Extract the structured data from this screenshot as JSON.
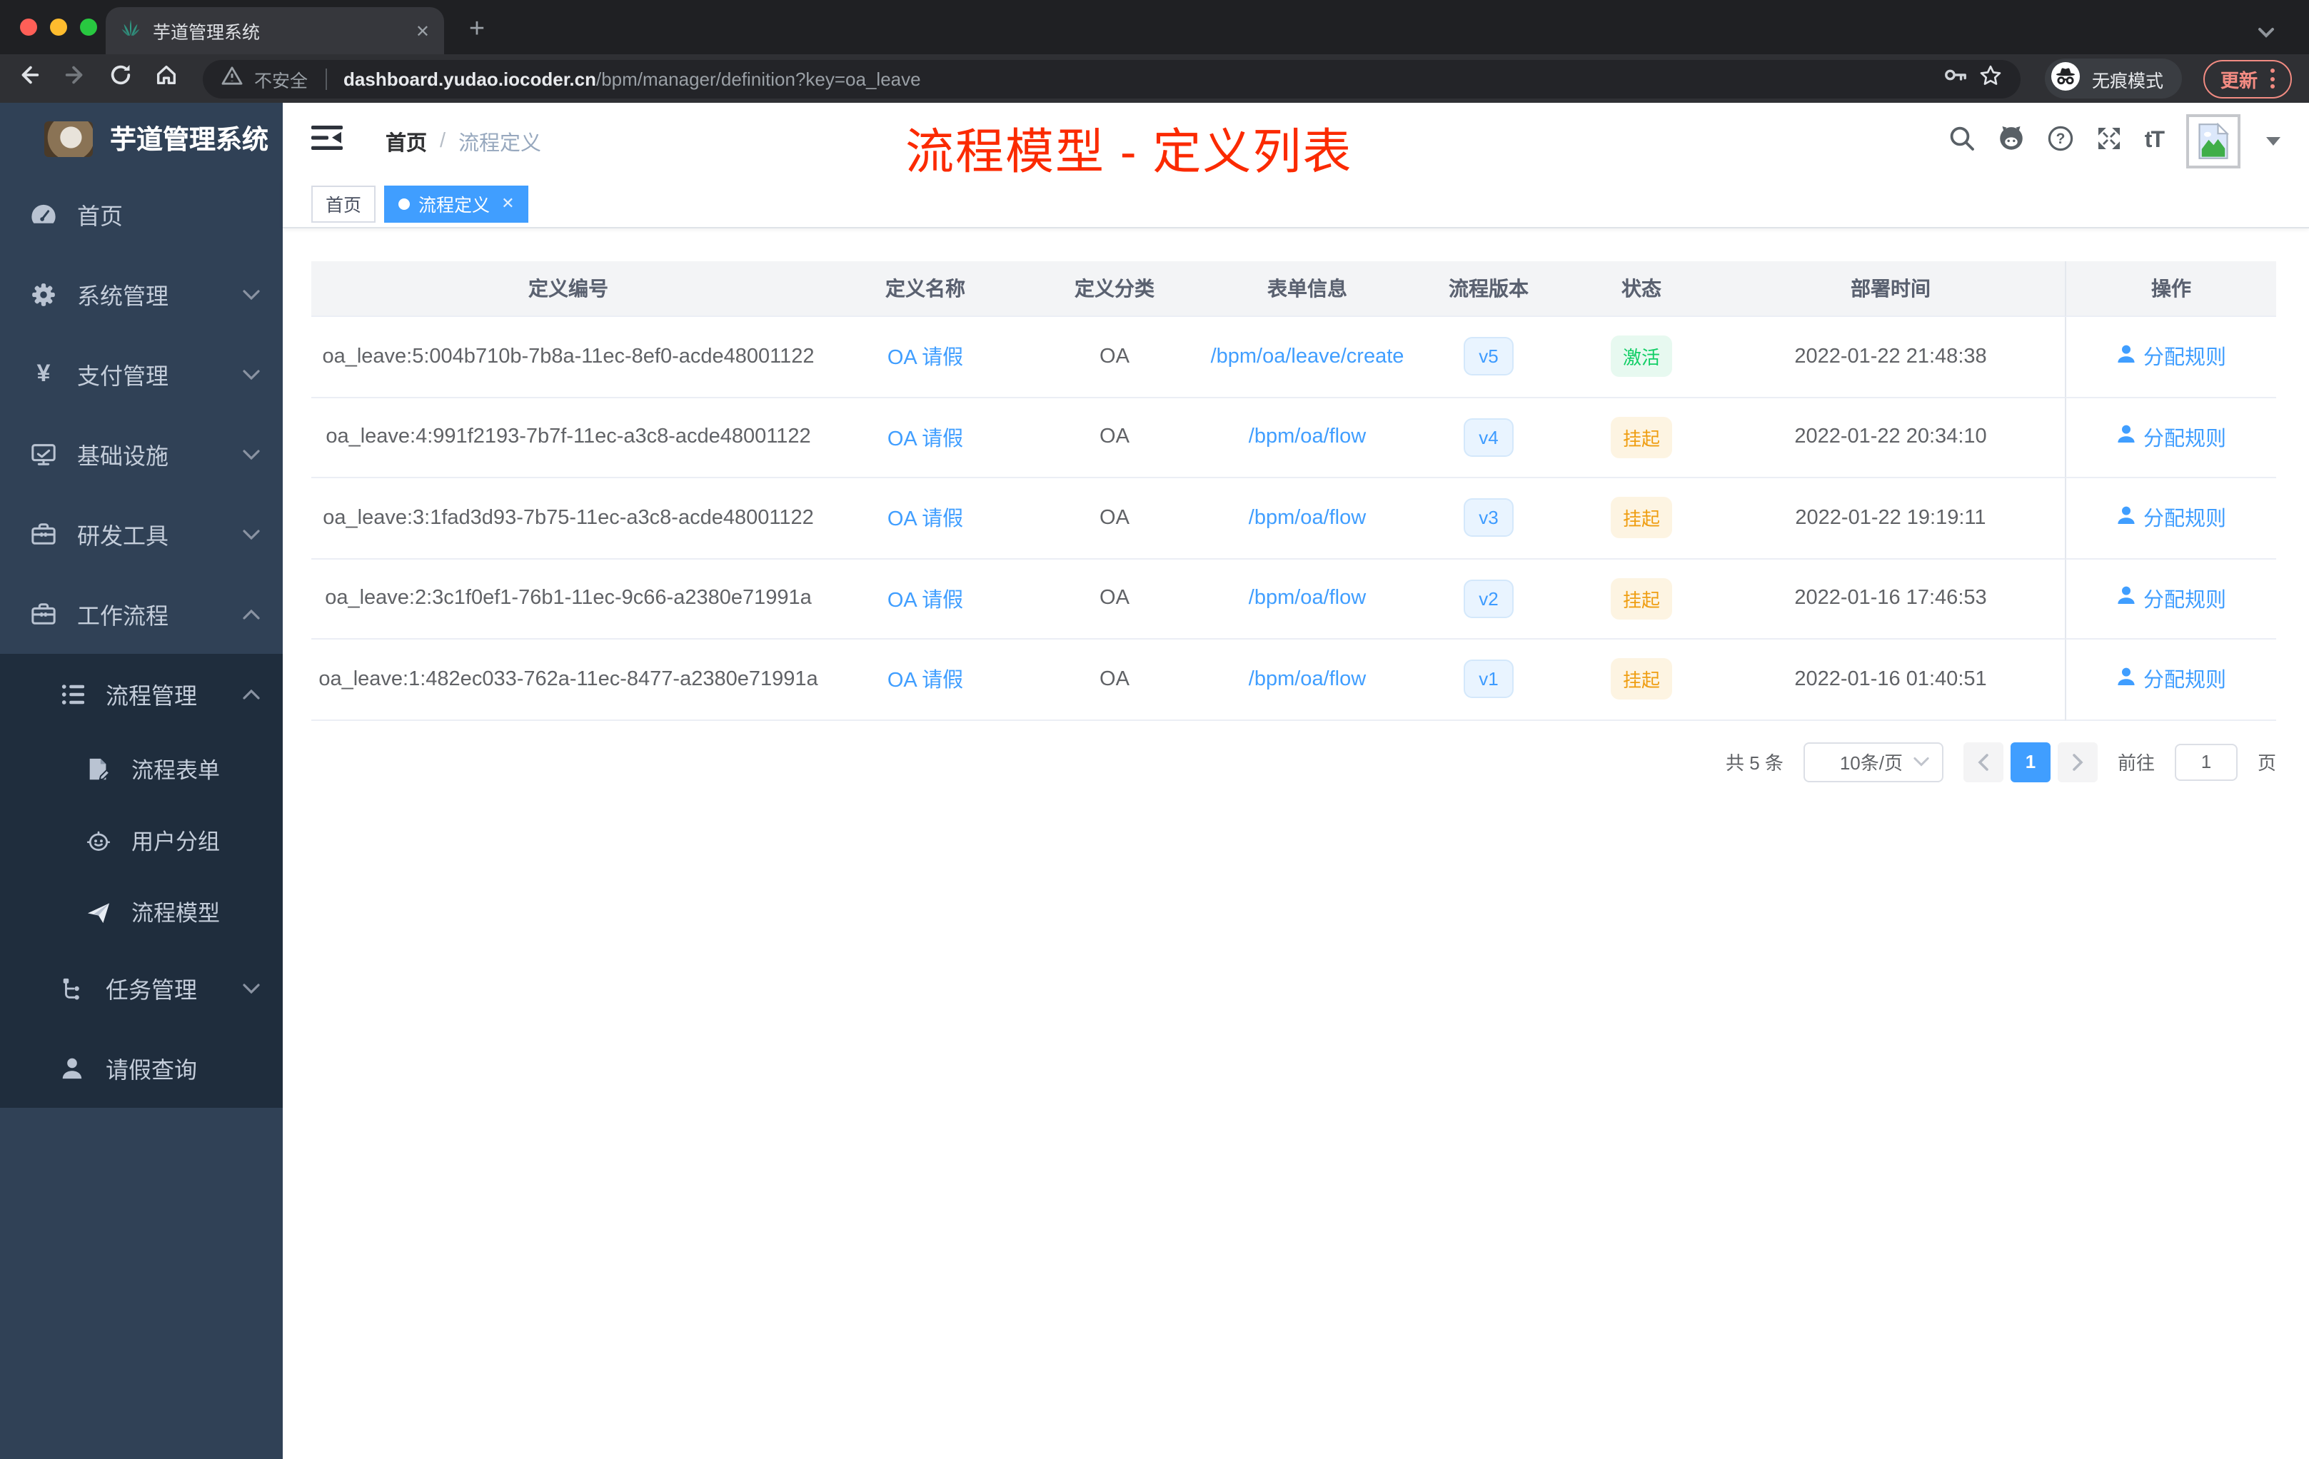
{
  "browser": {
    "tab_title": "芋道管理系统",
    "tab_close": "✕",
    "new_tab": "+",
    "security_label": "不安全",
    "url_domain": "dashboard.yudao.iocoder.cn",
    "url_path": "/bpm/manager/definition?key=oa_leave",
    "incognito_label": "无痕模式",
    "update_label": "更新"
  },
  "sidebar": {
    "logo_title": "芋道管理系统",
    "items": [
      {
        "label": "首页"
      },
      {
        "label": "系统管理"
      },
      {
        "label": "支付管理"
      },
      {
        "label": "基础设施"
      },
      {
        "label": "研发工具"
      },
      {
        "label": "工作流程"
      },
      {
        "label": "流程管理"
      },
      {
        "label": "流程表单"
      },
      {
        "label": "用户分组"
      },
      {
        "label": "流程模型"
      },
      {
        "label": "任务管理"
      },
      {
        "label": "请假查询"
      }
    ]
  },
  "navbar": {
    "breadcrumb_home": "首页",
    "breadcrumb_sep": "/",
    "breadcrumb_current": "流程定义",
    "annotation_title": "流程模型 - 定义列表",
    "font_size_icon_label": "tT"
  },
  "tags": {
    "home": "首页",
    "active": "流程定义",
    "close": "✕"
  },
  "table": {
    "columns": [
      "定义编号",
      "定义名称",
      "定义分类",
      "表单信息",
      "流程版本",
      "状态",
      "部署时间",
      "操作"
    ],
    "rows": [
      {
        "id": "oa_leave:5:004b710b-7b8a-11ec-8ef0-acde48001122",
        "name": "OA 请假",
        "category": "OA",
        "form": "/bpm/oa/leave/create",
        "version": "v5",
        "status": "激活",
        "status_type": "active",
        "deploy_time": "2022-01-22 21:48:38",
        "action": "分配规则"
      },
      {
        "id": "oa_leave:4:991f2193-7b7f-11ec-a3c8-acde48001122",
        "name": "OA 请假",
        "category": "OA",
        "form": "/bpm/oa/flow",
        "version": "v4",
        "status": "挂起",
        "status_type": "suspended",
        "deploy_time": "2022-01-22 20:34:10",
        "action": "分配规则"
      },
      {
        "id": "oa_leave:3:1fad3d93-7b75-11ec-a3c8-acde48001122",
        "name": "OA 请假",
        "category": "OA",
        "form": "/bpm/oa/flow",
        "version": "v3",
        "status": "挂起",
        "status_type": "suspended",
        "deploy_time": "2022-01-22 19:19:11",
        "action": "分配规则"
      },
      {
        "id": "oa_leave:2:3c1f0ef1-76b1-11ec-9c66-a2380e71991a",
        "name": "OA 请假",
        "category": "OA",
        "form": "/bpm/oa/flow",
        "version": "v2",
        "status": "挂起",
        "status_type": "suspended",
        "deploy_time": "2022-01-16 17:46:53",
        "action": "分配规则"
      },
      {
        "id": "oa_leave:1:482ec033-762a-11ec-8477-a2380e71991a",
        "name": "OA 请假",
        "category": "OA",
        "form": "/bpm/oa/flow",
        "version": "v1",
        "status": "挂起",
        "status_type": "suspended",
        "deploy_time": "2022-01-16 01:40:51",
        "action": "分配规则"
      }
    ]
  },
  "pagination": {
    "total": "共 5 条",
    "page_size": "10条/页",
    "current_page": "1",
    "goto_label": "前往",
    "goto_value": "1",
    "page_unit": "页"
  },
  "colors": {
    "accent_blue": "#409eff",
    "success_green": "#12ce66",
    "warning_orange": "#ef9e12",
    "annotation_red": "#fb2a00",
    "sidebar_bg": "#304156",
    "submenu_bg": "#1f2d3d",
    "traffic_red": "#ff5f57",
    "traffic_yellow": "#febc2e",
    "traffic_green": "#28c840",
    "update_salmon": "#f28b82"
  }
}
